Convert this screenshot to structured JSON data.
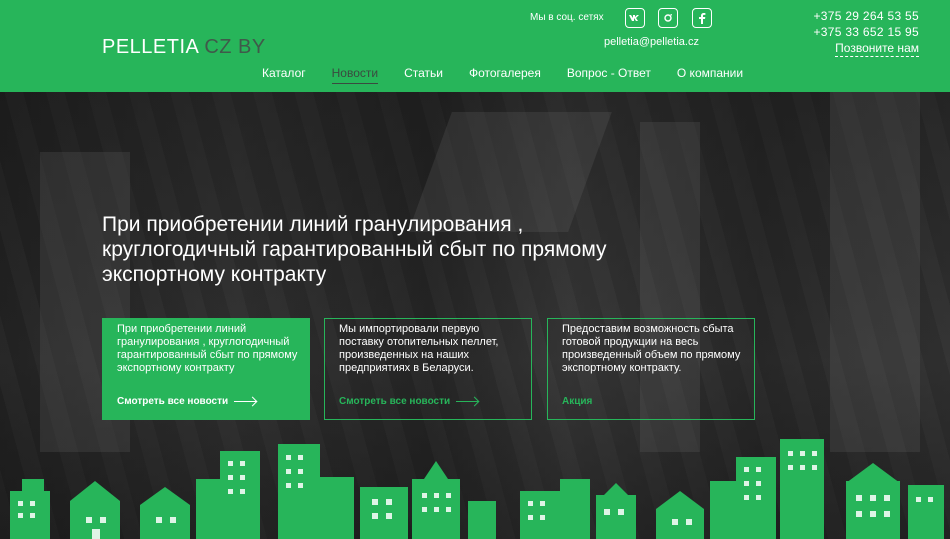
{
  "header": {
    "logo_main": "PELLETIA",
    "logo_sub": " CZ BY",
    "social_label": "Мы в соц. сетях",
    "email": "pelletia@pelletia.cz",
    "phones": [
      "+375 29 264 53 55",
      "+375 33 652 15 95"
    ],
    "callback": "Позвоните нам",
    "social_icons": [
      "vk-icon",
      "instagram-icon",
      "facebook-icon"
    ]
  },
  "nav": {
    "items": [
      {
        "label": "Каталог"
      },
      {
        "label": "Новости",
        "active": true
      },
      {
        "label": "Статьи"
      },
      {
        "label": "Фотогалерея"
      },
      {
        "label": "Вопрос - Ответ"
      },
      {
        "label": "О компании"
      }
    ]
  },
  "hero": {
    "headline": "При приобретении линий гранулирования , круглогодичный гарантированный сбыт по прямому экспортному контракту"
  },
  "cards": [
    {
      "text": "При приобретении линий гранулирования , круглогодичный гарантированный сбыт по прямому экспортному контракту",
      "link": "Смотреть все новости"
    },
    {
      "text": "Мы импортировали первую поставку отопительных пеллет, произведенных на наших предприятиях в Беларуси.",
      "link": "Смотреть все новости"
    },
    {
      "text": "Предоставим возможность сбыта готовой продукции  на весь произведенный объем по прямому экспортному контракту.",
      "link": "Акция"
    }
  ],
  "colors": {
    "brand_green": "#27b55a",
    "logo_sub": "#3f5a4a",
    "active_nav": "#3a4a40"
  }
}
